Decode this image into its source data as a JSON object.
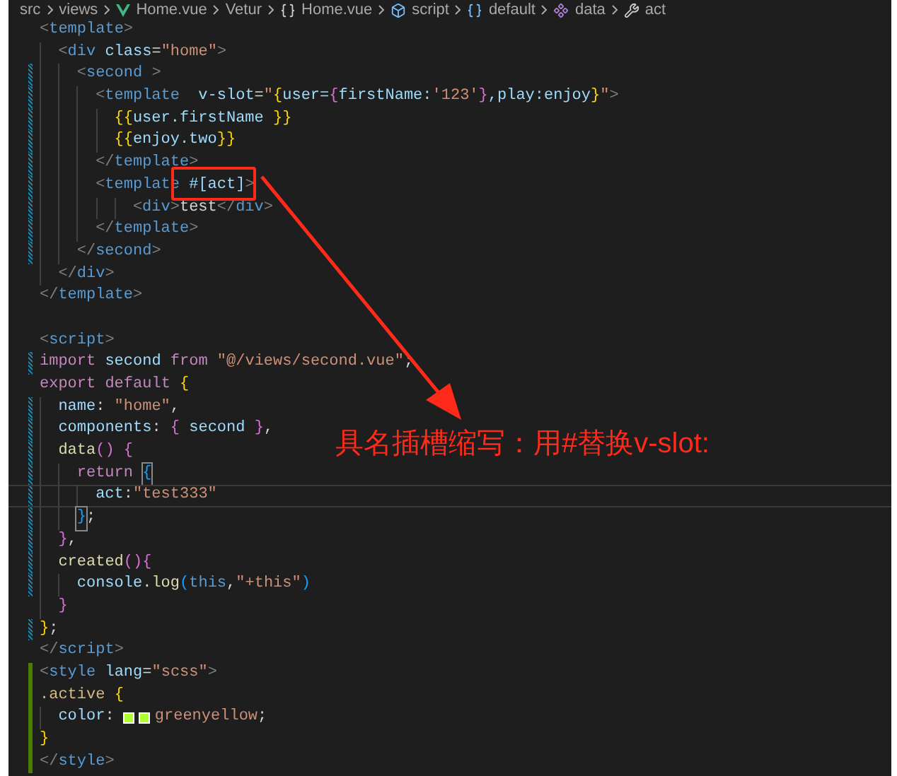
{
  "breadcrumb": [
    {
      "text": "src"
    },
    {
      "text": "views"
    },
    {
      "text": "Home.vue",
      "kind": "vue"
    },
    {
      "text": "Vetur"
    },
    {
      "text": "Home.vue",
      "kind": "braces"
    },
    {
      "text": "script",
      "kind": "cube"
    },
    {
      "text": "default",
      "kind": "module"
    },
    {
      "text": "data",
      "kind": "method"
    },
    {
      "text": "act",
      "kind": "wrench"
    }
  ],
  "lines": [
    {
      "modified": false,
      "added": false,
      "current": false,
      "tokens": [
        {
          "text": "<",
          "kind": "tag"
        },
        {
          "text": "template",
          "kind": "name"
        },
        {
          "text": ">",
          "kind": "tag"
        }
      ]
    },
    {
      "modified": false,
      "added": false,
      "current": false,
      "tokens": [
        {
          "text": "  <",
          "kind": "tag"
        },
        {
          "text": "div",
          "kind": "name"
        },
        {
          "text": " class",
          "kind": "attr"
        },
        {
          "text": "=",
          "kind": "plain"
        },
        {
          "text": "\"home\"",
          "kind": "str"
        },
        {
          "text": ">",
          "kind": "tag"
        }
      ]
    },
    {
      "modified": true,
      "added": false,
      "current": false,
      "tokens": [
        {
          "text": "    <",
          "kind": "tag"
        },
        {
          "text": "second",
          "kind": "name"
        },
        {
          "text": " >",
          "kind": "tag"
        }
      ]
    },
    {
      "modified": true,
      "added": false,
      "current": false,
      "tokens": [
        {
          "text": "      <",
          "kind": "tag"
        },
        {
          "text": "template",
          "kind": "name"
        },
        {
          "text": "  v-slot",
          "kind": "attr"
        },
        {
          "text": "=",
          "kind": "plain"
        },
        {
          "text": "\"",
          "kind": "str"
        },
        {
          "text": "{",
          "kind": "brace1"
        },
        {
          "text": "user=",
          "kind": "attr"
        },
        {
          "text": "{",
          "kind": "brace2"
        },
        {
          "text": "firstName:",
          "kind": "attr"
        },
        {
          "text": "'123'",
          "kind": "str"
        },
        {
          "text": "}",
          "kind": "brace2"
        },
        {
          "text": ",play:enjoy",
          "kind": "attr"
        },
        {
          "text": "}",
          "kind": "brace1"
        },
        {
          "text": "\"",
          "kind": "str"
        },
        {
          "text": ">",
          "kind": "tag"
        }
      ]
    },
    {
      "modified": true,
      "added": false,
      "current": false,
      "tokens": [
        {
          "text": "        {{",
          "kind": "brace1"
        },
        {
          "text": "user.firstName ",
          "kind": "attr"
        },
        {
          "text": "}}",
          "kind": "brace1"
        }
      ]
    },
    {
      "modified": true,
      "added": false,
      "current": false,
      "tokens": [
        {
          "text": "        {{",
          "kind": "brace1"
        },
        {
          "text": "enjoy.two",
          "kind": "attr"
        },
        {
          "text": "}}",
          "kind": "brace1"
        }
      ]
    },
    {
      "modified": true,
      "added": false,
      "current": false,
      "tokens": [
        {
          "text": "      </",
          "kind": "tag"
        },
        {
          "text": "template",
          "kind": "name"
        },
        {
          "text": ">",
          "kind": "tag"
        }
      ]
    },
    {
      "modified": true,
      "added": false,
      "current": false,
      "tokens": [
        {
          "text": "      <",
          "kind": "tag"
        },
        {
          "text": "template ",
          "kind": "name"
        },
        {
          "text": "#[act]",
          "kind": "attr"
        },
        {
          "text": ">",
          "kind": "tag"
        }
      ]
    },
    {
      "modified": true,
      "added": false,
      "current": false,
      "tokens": [
        {
          "text": "          <",
          "kind": "tag"
        },
        {
          "text": "div",
          "kind": "name"
        },
        {
          "text": ">",
          "kind": "tag"
        },
        {
          "text": "test",
          "kind": "plain"
        },
        {
          "text": "</",
          "kind": "tag"
        },
        {
          "text": "div",
          "kind": "name"
        },
        {
          "text": ">",
          "kind": "tag"
        }
      ]
    },
    {
      "modified": true,
      "added": false,
      "current": false,
      "tokens": [
        {
          "text": "      </",
          "kind": "tag"
        },
        {
          "text": "template",
          "kind": "name"
        },
        {
          "text": ">",
          "kind": "tag"
        }
      ]
    },
    {
      "modified": true,
      "added": false,
      "current": false,
      "tokens": [
        {
          "text": "    </",
          "kind": "tag"
        },
        {
          "text": "second",
          "kind": "name"
        },
        {
          "text": ">",
          "kind": "tag"
        }
      ]
    },
    {
      "modified": false,
      "added": false,
      "current": false,
      "tokens": [
        {
          "text": "  </",
          "kind": "tag"
        },
        {
          "text": "div",
          "kind": "name"
        },
        {
          "text": ">",
          "kind": "tag"
        }
      ]
    },
    {
      "modified": false,
      "added": false,
      "current": false,
      "tokens": [
        {
          "text": "</",
          "kind": "tag"
        },
        {
          "text": "template",
          "kind": "name"
        },
        {
          "text": ">",
          "kind": "tag"
        }
      ]
    },
    {
      "modified": false,
      "added": false,
      "current": false
    },
    {
      "modified": false,
      "added": false,
      "current": false,
      "tokens": [
        {
          "text": "<",
          "kind": "tag"
        },
        {
          "text": "script",
          "kind": "name"
        },
        {
          "text": ">",
          "kind": "tag"
        }
      ]
    },
    {
      "modified": true,
      "added": false,
      "current": false,
      "tokens": [
        {
          "text": "import",
          "kind": "kw"
        },
        {
          "text": " second ",
          "kind": "attr"
        },
        {
          "text": "from",
          "kind": "kw"
        },
        {
          "text": " \"@/views/second.vue\"",
          "kind": "str"
        },
        {
          "text": ";",
          "kind": "plain"
        }
      ]
    },
    {
      "modified": false,
      "added": false,
      "current": false,
      "tokens": [
        {
          "text": "export default ",
          "kind": "kw"
        },
        {
          "text": "{",
          "kind": "brace1"
        }
      ]
    },
    {
      "modified": true,
      "added": false,
      "current": false,
      "tokens": [
        {
          "text": "  name",
          "kind": "attr"
        },
        {
          "text": ": ",
          "kind": "plain"
        },
        {
          "text": "\"home\"",
          "kind": "str"
        },
        {
          "text": ",",
          "kind": "plain"
        }
      ]
    },
    {
      "modified": true,
      "added": false,
      "current": false,
      "tokens": [
        {
          "text": "  components",
          "kind": "attr"
        },
        {
          "text": ": ",
          "kind": "plain"
        },
        {
          "text": "{",
          "kind": "brace2"
        },
        {
          "text": " second ",
          "kind": "attr"
        },
        {
          "text": "}",
          "kind": "brace2"
        },
        {
          "text": ",",
          "kind": "plain"
        }
      ]
    },
    {
      "modified": true,
      "added": false,
      "current": false,
      "tokens": [
        {
          "text": "  data",
          "kind": "fn"
        },
        {
          "text": "() {",
          "kind": "brace2"
        }
      ]
    },
    {
      "modified": true,
      "added": false,
      "current": false,
      "tokens": [
        {
          "text": "    return ",
          "kind": "kw"
        },
        {
          "text": "{",
          "kind": "match"
        }
      ]
    },
    {
      "modified": true,
      "added": false,
      "current": true,
      "tokens": [
        {
          "text": "      act",
          "kind": "attr"
        },
        {
          "text": ":",
          "kind": "plain"
        },
        {
          "text": "\"test333\"",
          "kind": "str"
        }
      ]
    },
    {
      "modified": true,
      "added": false,
      "current": false,
      "tokens": [
        {
          "text": "    }",
          "kind": "match"
        },
        {
          "text": ";",
          "kind": "plain"
        }
      ]
    },
    {
      "modified": true,
      "added": false,
      "current": false,
      "tokens": [
        {
          "text": "  }",
          "kind": "brace2"
        },
        {
          "text": ",",
          "kind": "plain"
        }
      ]
    },
    {
      "modified": true,
      "added": false,
      "current": false,
      "tokens": [
        {
          "text": "  created",
          "kind": "fn"
        },
        {
          "text": "(){",
          "kind": "brace2"
        }
      ]
    },
    {
      "modified": true,
      "added": false,
      "current": false,
      "tokens": [
        {
          "text": "    console",
          "kind": "attr"
        },
        {
          "text": ".",
          "kind": "plain"
        },
        {
          "text": "log",
          "kind": "fn"
        },
        {
          "text": "(",
          "kind": "brace3"
        },
        {
          "text": "this",
          "kind": "name"
        },
        {
          "text": ",",
          "kind": "plain"
        },
        {
          "text": "\"+this\"",
          "kind": "str"
        },
        {
          "text": ")",
          "kind": "brace3"
        }
      ]
    },
    {
      "modified": false,
      "added": false,
      "current": false,
      "tokens": [
        {
          "text": "  }",
          "kind": "brace2"
        }
      ]
    },
    {
      "modified": true,
      "added": false,
      "current": false,
      "tokens": [
        {
          "text": "}",
          "kind": "brace1"
        },
        {
          "text": ";",
          "kind": "plain"
        }
      ]
    },
    {
      "modified": false,
      "added": false,
      "current": false,
      "tokens": [
        {
          "text": "</",
          "kind": "tag"
        },
        {
          "text": "script",
          "kind": "name"
        },
        {
          "text": ">",
          "kind": "tag"
        }
      ]
    },
    {
      "modified": false,
      "added": true,
      "current": false,
      "tokens": [
        {
          "text": "<",
          "kind": "tag"
        },
        {
          "text": "style",
          "kind": "name"
        },
        {
          "text": " lang",
          "kind": "attr"
        },
        {
          "text": "=",
          "kind": "plain"
        },
        {
          "text": "\"scss\"",
          "kind": "str"
        },
        {
          "text": ">",
          "kind": "tag"
        }
      ]
    },
    {
      "modified": false,
      "added": true,
      "current": false,
      "tokens": [
        {
          "text": ".active ",
          "kind": "selector"
        },
        {
          "text": "{",
          "kind": "brace1"
        }
      ]
    },
    {
      "modified": false,
      "added": true,
      "current": false,
      "tokens": [
        {
          "text": "  color",
          "kind": "attr"
        },
        {
          "text": ": ",
          "kind": "plain"
        },
        {
          "kind": "swatch",
          "color": "#adff2f"
        },
        {
          "kind": "swatch",
          "color": "#adff2f"
        },
        {
          "text": "greenyellow",
          "kind": "str"
        },
        {
          "text": ";",
          "kind": "plain"
        }
      ]
    },
    {
      "modified": false,
      "added": true,
      "current": false,
      "tokens": [
        {
          "text": "}",
          "kind": "brace1"
        }
      ]
    },
    {
      "modified": false,
      "added": true,
      "current": false,
      "tokens": [
        {
          "text": "</",
          "kind": "tag"
        },
        {
          "text": "style",
          "kind": "name"
        },
        {
          "text": ">",
          "kind": "tag"
        }
      ]
    }
  ],
  "annotation": {
    "text": "具名插槽缩写：用#替换v-slot:"
  }
}
